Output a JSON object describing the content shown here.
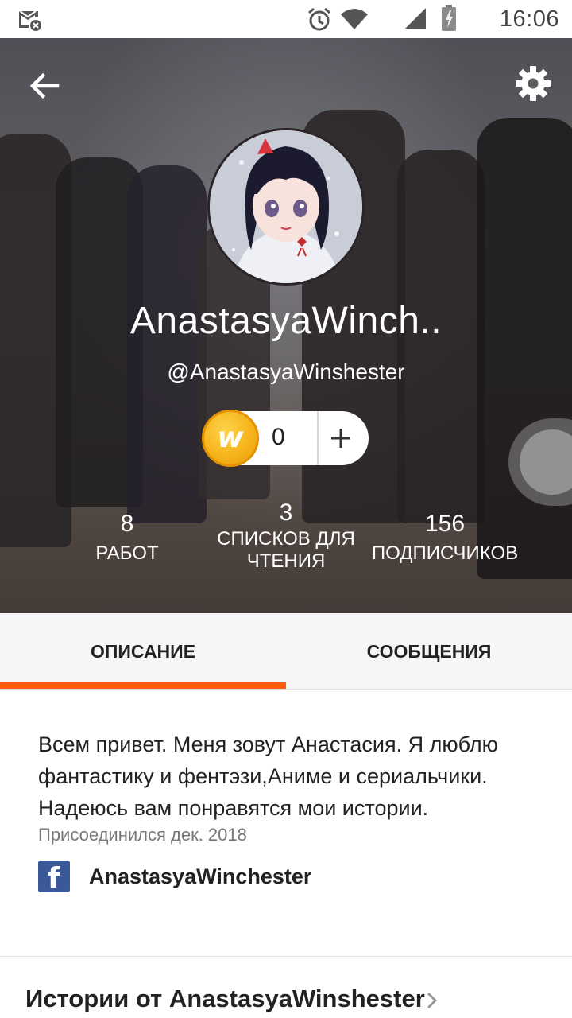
{
  "status_bar": {
    "time": "16:06",
    "icons": [
      "mail-blocked-icon",
      "alarm-icon",
      "wifi-icon",
      "signal-icon",
      "battery-charging-icon"
    ]
  },
  "header": {
    "back_icon": "arrow-left-icon",
    "settings_icon": "gear-icon",
    "display_name": "AnastasyaWinch..",
    "username": "@AnastasyaWinshester",
    "coins": {
      "letter": "w",
      "count": "0",
      "add_label": "+"
    },
    "stats": [
      {
        "value": "8",
        "label": "РАБОТ"
      },
      {
        "value": "3",
        "label": "СПИСКОВ ДЛЯ ЧТЕНИЯ"
      },
      {
        "value": "156",
        "label": "ПОДПИСЧИКОВ"
      }
    ]
  },
  "tabs": {
    "items": [
      {
        "label": "ОПИСАНИЕ",
        "active": true
      },
      {
        "label": "СООБЩЕНИЯ",
        "active": false
      }
    ],
    "accent_color": "#ff5a0f"
  },
  "about": {
    "text": "Всем привет. Меня зовут Анастасия. Я люблю фантастику и фентэзи,Аниме и сериальчики. Надеюсь вам понравятся мои истории.",
    "joined": "Присоединился дек. 2018",
    "facebook": {
      "icon_letter": "f",
      "name": "AnastasyaWinchester"
    }
  },
  "stories": {
    "title": "Истории от AnastasyaWinshester"
  }
}
